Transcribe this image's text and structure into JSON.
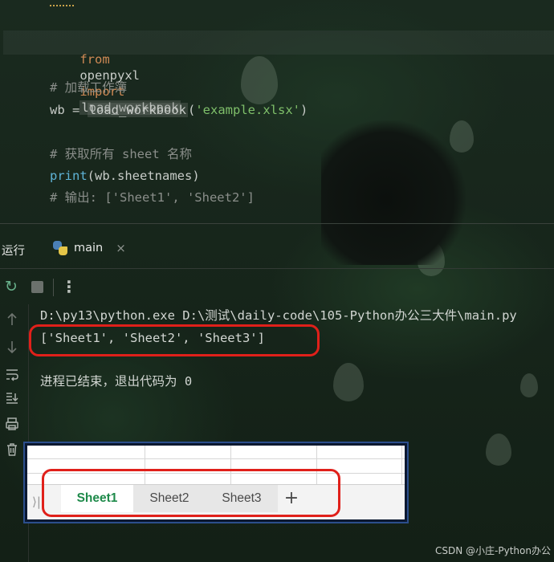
{
  "editor": {
    "line1": {
      "kw_from": "from",
      "module": "openpyxl",
      "kw_import": "import",
      "name": "load_workbook"
    },
    "comment_load": "# 加载工作簿",
    "line2": {
      "var": "wb = ",
      "call": "load_workbook",
      "open": "(",
      "arg": "'example.xlsx'",
      "close": ")"
    },
    "comment_get": "# 获取所有 sheet 名称",
    "line3": {
      "call": "print",
      "rest": "(wb.sheetnames)"
    },
    "comment_out": "# 输出: ['Sheet1', 'Sheet2']"
  },
  "run_panel": {
    "title": "运行",
    "tab": {
      "label": "main",
      "close": "×"
    },
    "toolbar": {
      "rerun": "↻",
      "more": "⋮"
    },
    "gutter_icons": [
      "up-arrow-icon",
      "down-arrow-icon",
      "soft-wrap-icon",
      "scroll-to-end-icon",
      "print-icon",
      "trash-icon"
    ],
    "console": {
      "command": "D:\\py13\\python.exe D:\\测试\\daily-code\\105-Python办公三大件\\main.py",
      "output": "['Sheet1', 'Sheet2', 'Sheet3']",
      "exit": "进程已结束，退出代码为 0"
    }
  },
  "excel": {
    "sheets": [
      "Sheet1",
      "Sheet2",
      "Sheet3"
    ],
    "active_sheet": "Sheet1",
    "add_label": "+",
    "nav_mark": "⟩|"
  },
  "highlight_color": "#e0201a",
  "watermark": "CSDN @小庄-Python办公"
}
